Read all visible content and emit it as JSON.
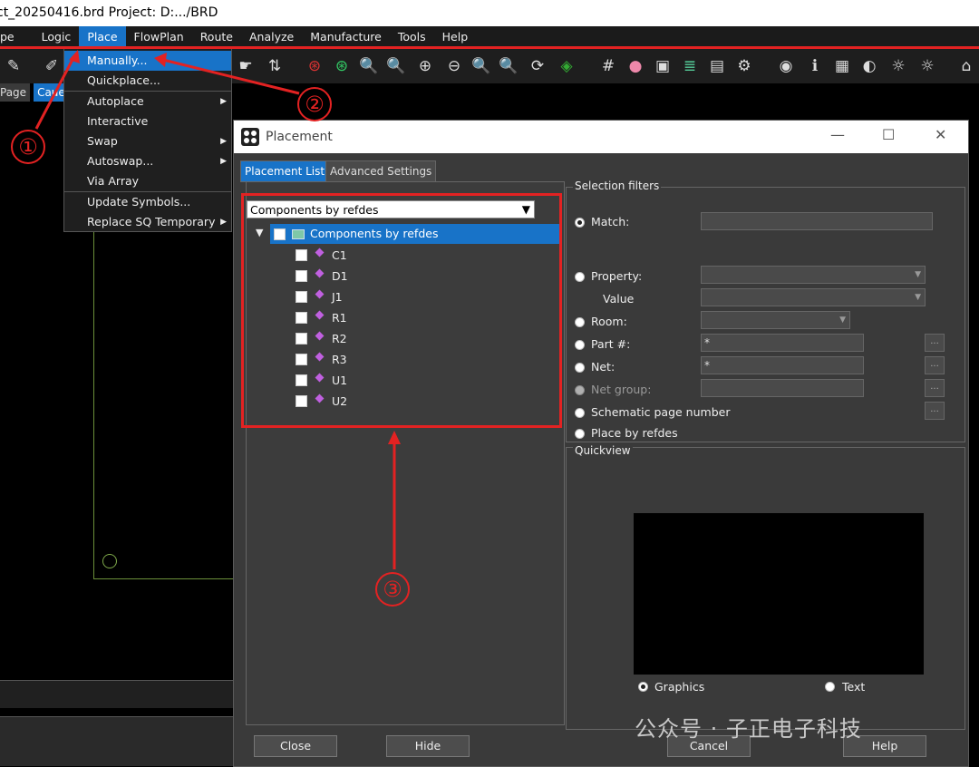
{
  "window": {
    "title": "ct_20250416.brd  Project: D:.../BRD"
  },
  "menubar": {
    "items": [
      "pe",
      "Logic",
      "Place",
      "FlowPlan",
      "Route",
      "Analyze",
      "Manufacture",
      "Tools",
      "Help"
    ],
    "active": "Place"
  },
  "left_tabs": [
    "Page",
    "Cauer"
  ],
  "place_menu": {
    "items": [
      {
        "label": "Manually..."
      },
      {
        "label": "Quickplace..."
      },
      {
        "label": "Autoplace"
      },
      {
        "label": "Interactive"
      },
      {
        "label": "Swap"
      },
      {
        "label": "Autoswap..."
      },
      {
        "label": "Via Array"
      },
      {
        "label": "Update Symbols..."
      },
      {
        "label": "Replace SQ Temporary"
      }
    ]
  },
  "dialog": {
    "title": "Placement",
    "tabs": [
      "Placement List",
      "Advanced Settings"
    ],
    "combo_value": "Components by refdes",
    "tree": {
      "root": "Components by refdes",
      "items": [
        "C1",
        "D1",
        "J1",
        "R1",
        "R2",
        "R3",
        "U1",
        "U2"
      ]
    },
    "filters": {
      "title": "Selection filters",
      "match": "Match:",
      "property": "Property:",
      "value": "Value",
      "room": "Room:",
      "part": "Part #:",
      "part_value": "*",
      "net": "Net:",
      "net_value": "*",
      "net_group": "Net group:",
      "schematic": "Schematic page number",
      "place_refdes": "Place by refdes",
      "dots": "..."
    },
    "quickview": {
      "title": "Quickview",
      "graphics": "Graphics",
      "text": "Text"
    },
    "buttons": {
      "close": "Close",
      "hide": "Hide",
      "cancel": "Cancel",
      "help": "Help"
    }
  },
  "annotations": {
    "n1": "①",
    "n2": "②",
    "n3": "③"
  },
  "watermark": "公众号 · 子正电子科技",
  "colors": {
    "accent": "#1873c8",
    "annotation": "#e32222",
    "component_icon": "#c060e0"
  }
}
